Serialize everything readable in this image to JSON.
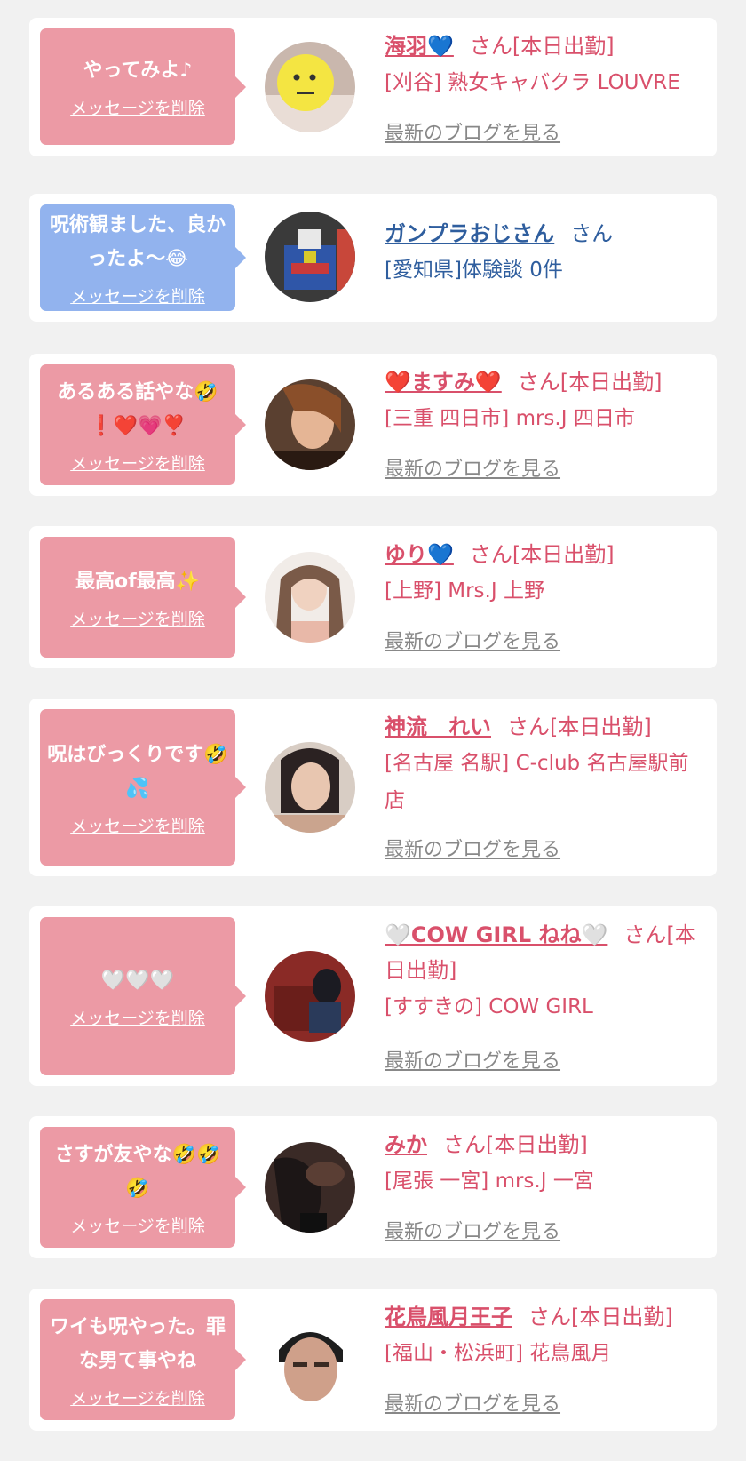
{
  "delete_label": "メッセージを削除",
  "blog_label": "最新のブログを見る",
  "honorific_working": "さん[本日出勤]",
  "honorific": "さん",
  "colors": {
    "background": "#f1f1f1",
    "bubble_pink": "#ec9aa5",
    "bubble_blue": "#92b3ee",
    "name_pink": "#d9506b",
    "name_blue": "#2f5e9e",
    "blog_gray": "#888888"
  },
  "items": [
    {
      "message": "やってみよ♪",
      "name": "海羽💙",
      "shop": "[刈谷] 熟女キャバクラ LOUVRE"
    },
    {
      "message": "呪術観ました、良かったよ〜😂",
      "name": "ガンプラおじさん",
      "shop": "[愛知県]体験談 0件"
    },
    {
      "message": "あるある話やな🤣❗❤️💗❣️",
      "name": "❤️ますみ❤️",
      "shop": "[三重 四日市] mrs.J 四日市"
    },
    {
      "message": "最高of最高✨",
      "name": "ゆり💙",
      "shop": "[上野] Mrs.J 上野"
    },
    {
      "message": "呪はびっくりです🤣💦",
      "name": "神流　れい",
      "shop": "[名古屋 名駅] C-club 名古屋駅前店"
    },
    {
      "message": "🤍🤍🤍",
      "name": "🤍COW GIRL ねね🤍",
      "shop": "[すすきの] COW GIRL"
    },
    {
      "message": "さすが友やな🤣🤣🤣",
      "name": "みか",
      "shop": "[尾張 一宮] mrs.J 一宮"
    },
    {
      "message": "ワイも呪やった。罪な男て事やね",
      "name": "花鳥風月王子",
      "shop": "[福山・松浜町] 花鳥風月"
    }
  ]
}
